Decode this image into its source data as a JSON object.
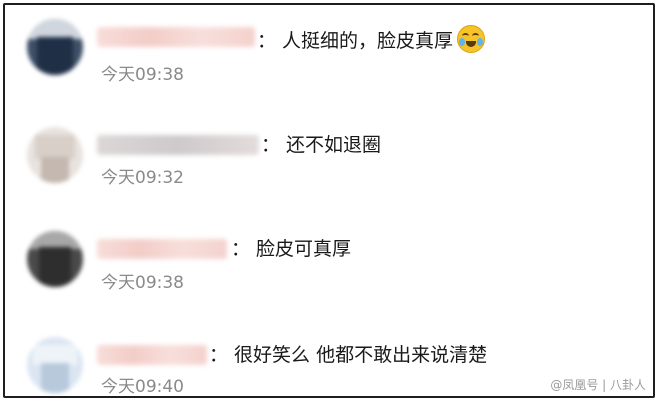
{
  "comments": [
    {
      "text": "： 人挺细的，脸皮真厚",
      "time": "今天09:38",
      "emoji": "laughing-crying-emoji"
    },
    {
      "text": "： 还不如退圈",
      "time": "今天09:32"
    },
    {
      "text": "： 脸皮可真厚",
      "time": "今天09:38"
    },
    {
      "text": "： 很好笑么 他都不敢出来说清楚",
      "time": "今天09:40"
    }
  ],
  "watermark": "@凤凰号 | 八卦人",
  "colors": {
    "time": "#8a8a8a",
    "border": "#1e1e1e",
    "name_blur": "#f2c8c3"
  }
}
